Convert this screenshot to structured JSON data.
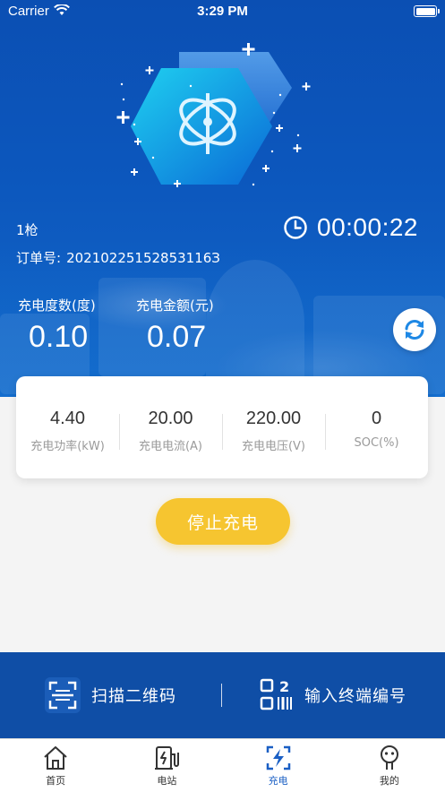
{
  "status_bar": {
    "carrier": "Carrier",
    "time": "3:29 PM"
  },
  "session": {
    "gun_label": "1枪",
    "order_label": "订单号:",
    "order_number": "20210225152853116З",
    "timer": "00:00:22"
  },
  "metrics": {
    "energy": {
      "label": "充电度数(度)",
      "value": "0.10"
    },
    "amount": {
      "label": "充电金额(元)",
      "value": "0.07"
    }
  },
  "stats": [
    {
      "value": "4.40",
      "label": "充电功率(kW)"
    },
    {
      "value": "20.00",
      "label": "充电电流(A)"
    },
    {
      "value": "220.00",
      "label": "充电电压(V)"
    },
    {
      "value": "0",
      "label": "SOC(%)"
    }
  ],
  "stop_button": "停止充电",
  "actions": {
    "scan": "扫描二维码",
    "input": "输入终端编号"
  },
  "tabs": [
    {
      "label": "首页",
      "icon": "home-icon"
    },
    {
      "label": "电站",
      "icon": "station-icon"
    },
    {
      "label": "充电",
      "icon": "charge-icon"
    },
    {
      "label": "我的",
      "icon": "profile-icon"
    }
  ],
  "colors": {
    "primary": "#0f4ea6",
    "accent": "#f6c530",
    "active_tab": "#1a5fc4"
  }
}
